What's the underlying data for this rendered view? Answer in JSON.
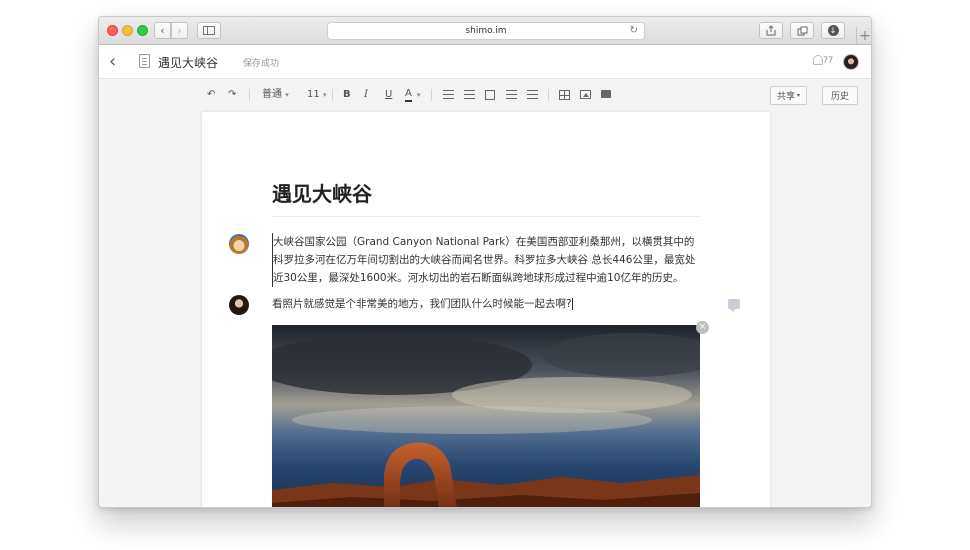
{
  "browser": {
    "url": "shimo.im",
    "nav_back": "‹",
    "nav_forward": "›",
    "reload": "↻",
    "new_tab": "+"
  },
  "header": {
    "back": "‹",
    "doc_name": "遇见大峡谷",
    "save_status": "保存成功",
    "notification_count": "77"
  },
  "toolbar": {
    "undo": "↶",
    "redo": "↷",
    "style_select": "普通",
    "size_select": "11",
    "bold": "B",
    "italic": "I",
    "underline": "U",
    "font_color": "A",
    "share": "共享",
    "history": "历史"
  },
  "document": {
    "title": "遇见大峡谷",
    "paragraph1": "大峡谷国家公园（Grand Canyon National Park）在美国西部亚利桑那州，以横贯其中的科罗拉多河在亿万年间切割出的大峡谷而闻名世界。科罗拉多大峡谷 总长446公里，最宽处近30公里，最深处1600米。河水切出的岩石断面纵跨地球形成过程中逾10亿年的历史。",
    "paragraph2": "看照片就感觉是个非常美的地方，我们团队什么时候能一起去啊?",
    "photo_close": "×"
  },
  "colors": {
    "accent_text": "#333333",
    "muted_text": "#999999",
    "comment_icon": "#c6cdd6"
  }
}
